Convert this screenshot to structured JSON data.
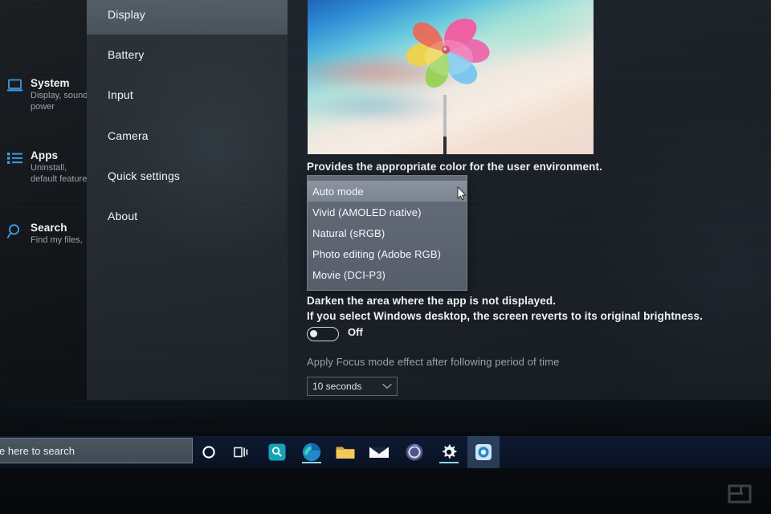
{
  "window": {
    "title": "Settings"
  },
  "categories": [
    {
      "icon": "laptop-icon",
      "title": "System",
      "subtitle": "Display, sound, power"
    },
    {
      "icon": "list-icon",
      "title": "Apps",
      "subtitle": "Uninstall, default features"
    },
    {
      "icon": "magnifier-icon",
      "title": "Search",
      "subtitle": "Find my files,"
    }
  ],
  "nav": {
    "items": [
      {
        "label": "Display",
        "selected": true
      },
      {
        "label": "Battery",
        "selected": false
      },
      {
        "label": "Input",
        "selected": false
      },
      {
        "label": "Camera",
        "selected": false
      },
      {
        "label": "Quick settings",
        "selected": false
      },
      {
        "label": "About",
        "selected": false
      }
    ]
  },
  "content": {
    "color_mode_description": "Provides the appropriate color for the user environment.",
    "color_mode_options": [
      {
        "label": "Auto mode",
        "highlighted": true
      },
      {
        "label": "Vivid (AMOLED native)",
        "highlighted": false
      },
      {
        "label": "Natural (sRGB)",
        "highlighted": false
      },
      {
        "label": "Photo editing (Adobe RGB)",
        "highlighted": false
      },
      {
        "label": "Movie (DCI-P3)",
        "highlighted": false
      }
    ],
    "focus_mode_line_1": "Darken the area where the app is not displayed.",
    "focus_mode_line_2": "If you select Windows desktop, the screen reverts to its original brightness.",
    "focus_toggle_state": "Off",
    "focus_delay_label": "Apply Focus mode effect after following period of time",
    "focus_delay_value": "10 seconds",
    "focus_delay_chevron": "chevron-down-icon",
    "preview_image_alt": "colorful-pinwheel-wallpaper"
  },
  "taskbar": {
    "search_placeholder": "e here to search",
    "icons": [
      {
        "name": "cortana-icon",
        "active": false,
        "underline": false
      },
      {
        "name": "task-view-icon",
        "active": false,
        "underline": false
      },
      {
        "name": "search-app-icon",
        "active": false,
        "underline": false
      },
      {
        "name": "edge-browser-icon",
        "active": false,
        "underline": true
      },
      {
        "name": "file-explorer-icon",
        "active": false,
        "underline": false
      },
      {
        "name": "mail-icon",
        "active": false,
        "underline": false
      },
      {
        "name": "circle-app-icon",
        "active": false,
        "underline": false
      },
      {
        "name": "settings-gear-icon",
        "active": false,
        "underline": true
      },
      {
        "name": "display-app-icon",
        "active": true,
        "underline": false
      }
    ]
  },
  "watermark": {
    "name": "engadget-logo"
  },
  "colors": {
    "accent_blue": "#3d9ae0",
    "taskbar_bg": "#0a1429",
    "nav_bg": "#252c32",
    "dropdown_bg": "#5c6472",
    "highlight": "#a8b2be",
    "text_primary": "#f2f4f6",
    "text_dim": "#9aa3ab",
    "underline_teal": "#8fd8ef"
  }
}
